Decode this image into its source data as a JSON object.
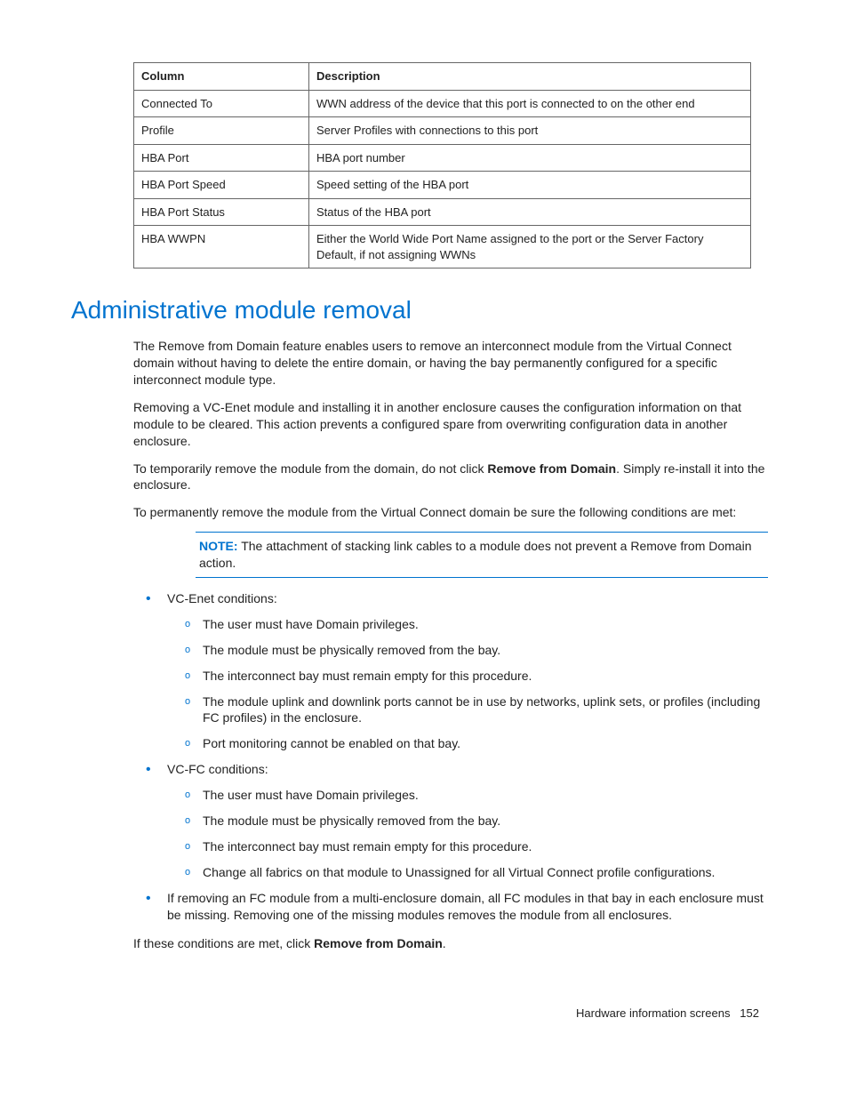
{
  "table": {
    "headers": [
      "Column",
      "Description"
    ],
    "rows": [
      [
        "Connected To",
        "WWN address of the device that this port is connected to on the other end"
      ],
      [
        "Profile",
        "Server Profiles with connections to this port"
      ],
      [
        "HBA Port",
        "HBA port number"
      ],
      [
        "HBA Port Speed",
        "Speed setting of the HBA port"
      ],
      [
        "HBA Port Status",
        "Status of the HBA port"
      ],
      [
        "HBA WWPN",
        "Either the World Wide Port Name assigned to the port or the Server Factory Default, if not assigning WWNs"
      ]
    ]
  },
  "heading": "Administrative module removal",
  "paras": {
    "p1": "The Remove from Domain feature enables users to remove an interconnect module from the Virtual Connect domain without having to delete the entire domain, or having the bay permanently configured for a specific interconnect module type.",
    "p2": "Removing a VC-Enet module and installing it in another enclosure causes the configuration information on that module to be cleared. This action prevents a configured spare from overwriting configuration data in another enclosure.",
    "p3a": "To temporarily remove the module from the domain, do not click ",
    "p3b": "Remove from Domain",
    "p3c": ". Simply re-install it into the enclosure.",
    "p4": "To permanently remove the module from the Virtual Connect domain be sure the following conditions are met:",
    "note_label": "NOTE:",
    "note_text": "  The attachment of stacking link cables to a module does not prevent a Remove from Domain action.",
    "p5a": "If these conditions are met, click ",
    "p5b": "Remove from Domain",
    "p5c": "."
  },
  "bullets": {
    "b1": "VC-Enet conditions:",
    "b1_sub": [
      "The user must have Domain privileges.",
      "The module must be physically removed from the bay.",
      "The interconnect bay must remain empty for this procedure.",
      "The module uplink and downlink ports cannot be in use by networks, uplink sets, or profiles (including FC profiles) in the enclosure.",
      "Port monitoring cannot be enabled on that bay."
    ],
    "b2": "VC-FC conditions:",
    "b2_sub": [
      "The user must have Domain privileges.",
      "The module must be physically removed from the bay.",
      "The interconnect bay must remain empty for this procedure.",
      "Change all fabrics on that module to Unassigned for all Virtual Connect profile configurations."
    ],
    "b3": "If removing an FC module from a multi-enclosure domain, all FC modules in that bay in each enclosure must be missing. Removing one of the missing modules removes the module from all enclosures."
  },
  "footer": {
    "section": "Hardware information screens",
    "page": "152"
  }
}
